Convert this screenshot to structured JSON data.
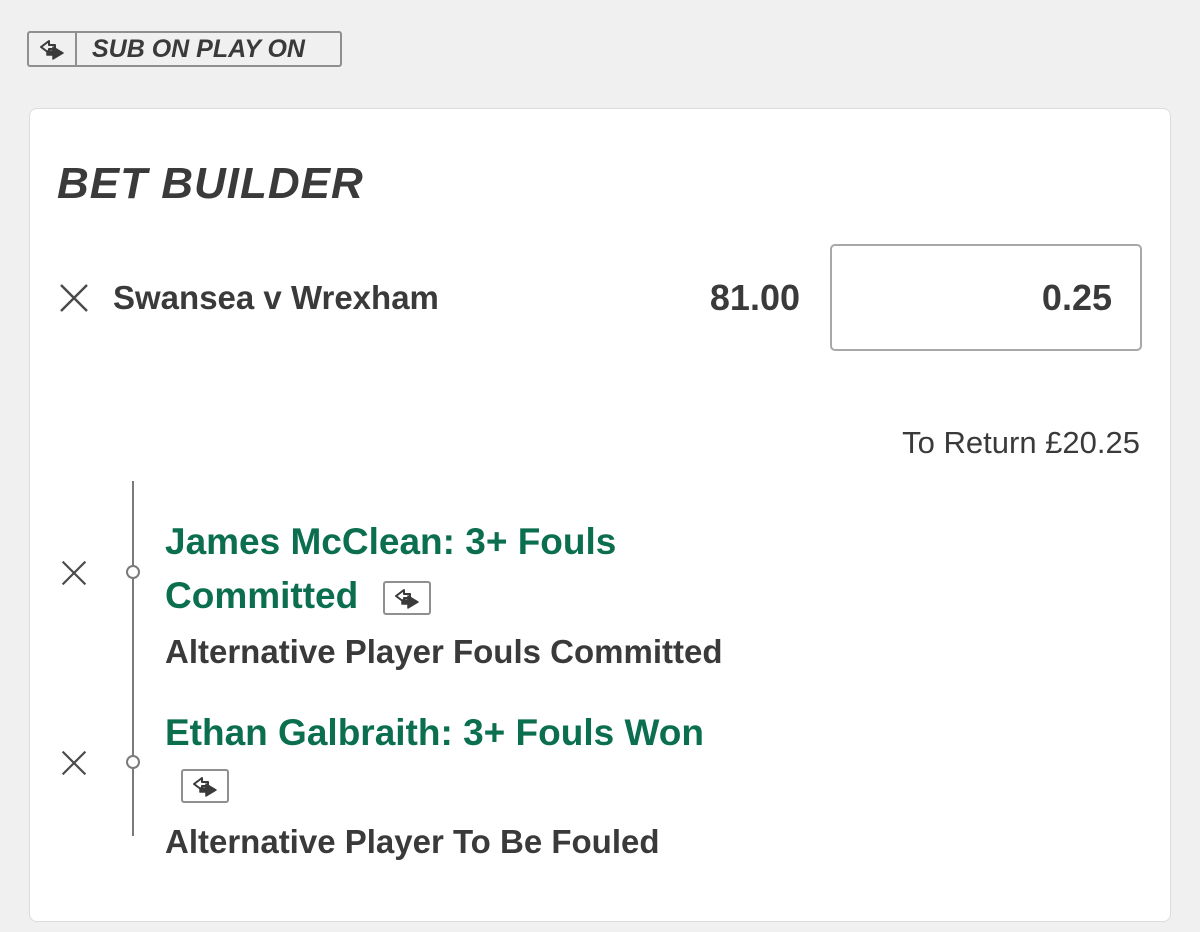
{
  "badge": {
    "label": "SUB ON PLAY ON",
    "icon": "swap-arrows-icon"
  },
  "bet_builder": {
    "title": "BET BUILDER",
    "event": "Swansea v Wrexham",
    "odds": "81.00",
    "stake_value": "0.25",
    "to_return": "To Return £20.25",
    "selections": [
      {
        "title": "James McClean: 3+ Fouls Committed",
        "subtitle": "Alternative Player Fouls Committed",
        "icon": "swap-arrows-icon"
      },
      {
        "title": "Ethan Galbraith: 3+ Fouls Won",
        "subtitle": "Alternative Player To Be Fouled",
        "icon": "swap-arrows-icon"
      }
    ]
  },
  "colors": {
    "selection_green": "#0b6e4f",
    "text_dark": "#3a3a3a",
    "background": "#f0f0f0",
    "border": "#8f8f8f"
  }
}
